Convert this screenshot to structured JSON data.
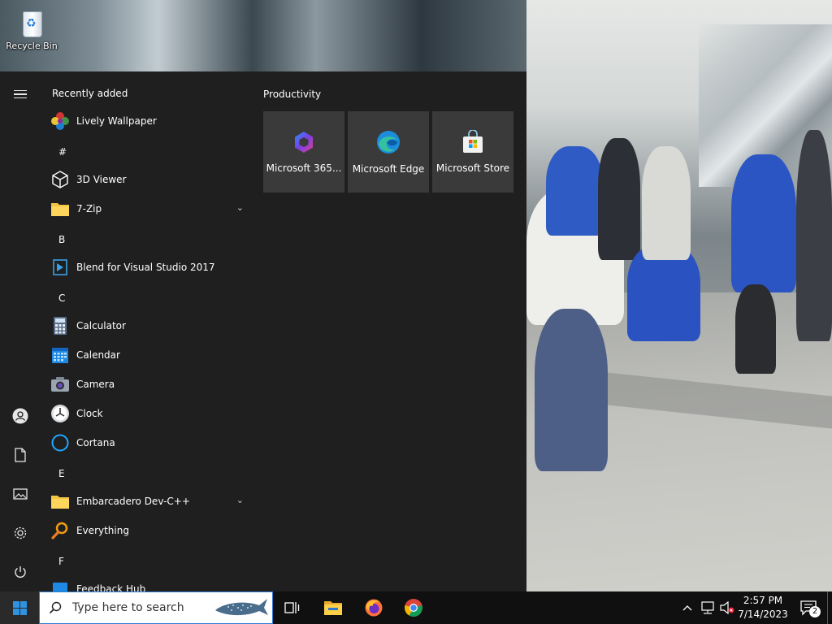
{
  "desktop": {
    "recycle_bin_label": "Recycle Bin"
  },
  "start_menu": {
    "recently_added_title": "Recently added",
    "letters": [
      "#",
      "B",
      "C",
      "E",
      "F"
    ],
    "apps": {
      "lively": "Lively Wallpaper",
      "viewer3d": "3D Viewer",
      "zip7": "7-Zip",
      "blend": "Blend for Visual Studio 2017",
      "calculator": "Calculator",
      "calendar": "Calendar",
      "camera": "Camera",
      "clock": "Clock",
      "cortana": "Cortana",
      "embarcadero": "Embarcadero Dev-C++",
      "everything": "Everything",
      "feedback": "Feedback Hub"
    },
    "tile_group_title": "Productivity",
    "tiles": [
      "Microsoft 365...",
      "Microsoft Edge",
      "Microsoft Store"
    ]
  },
  "taskbar": {
    "search_placeholder": "Type here to search",
    "time": "2:57 PM",
    "date": "7/14/2023",
    "notification_count": "2"
  },
  "colors": {
    "start_bg": "#1f1f1f",
    "tile_bg": "#3a3a3a",
    "taskbar_bg": "#101010",
    "accent": "#2f93e0"
  }
}
